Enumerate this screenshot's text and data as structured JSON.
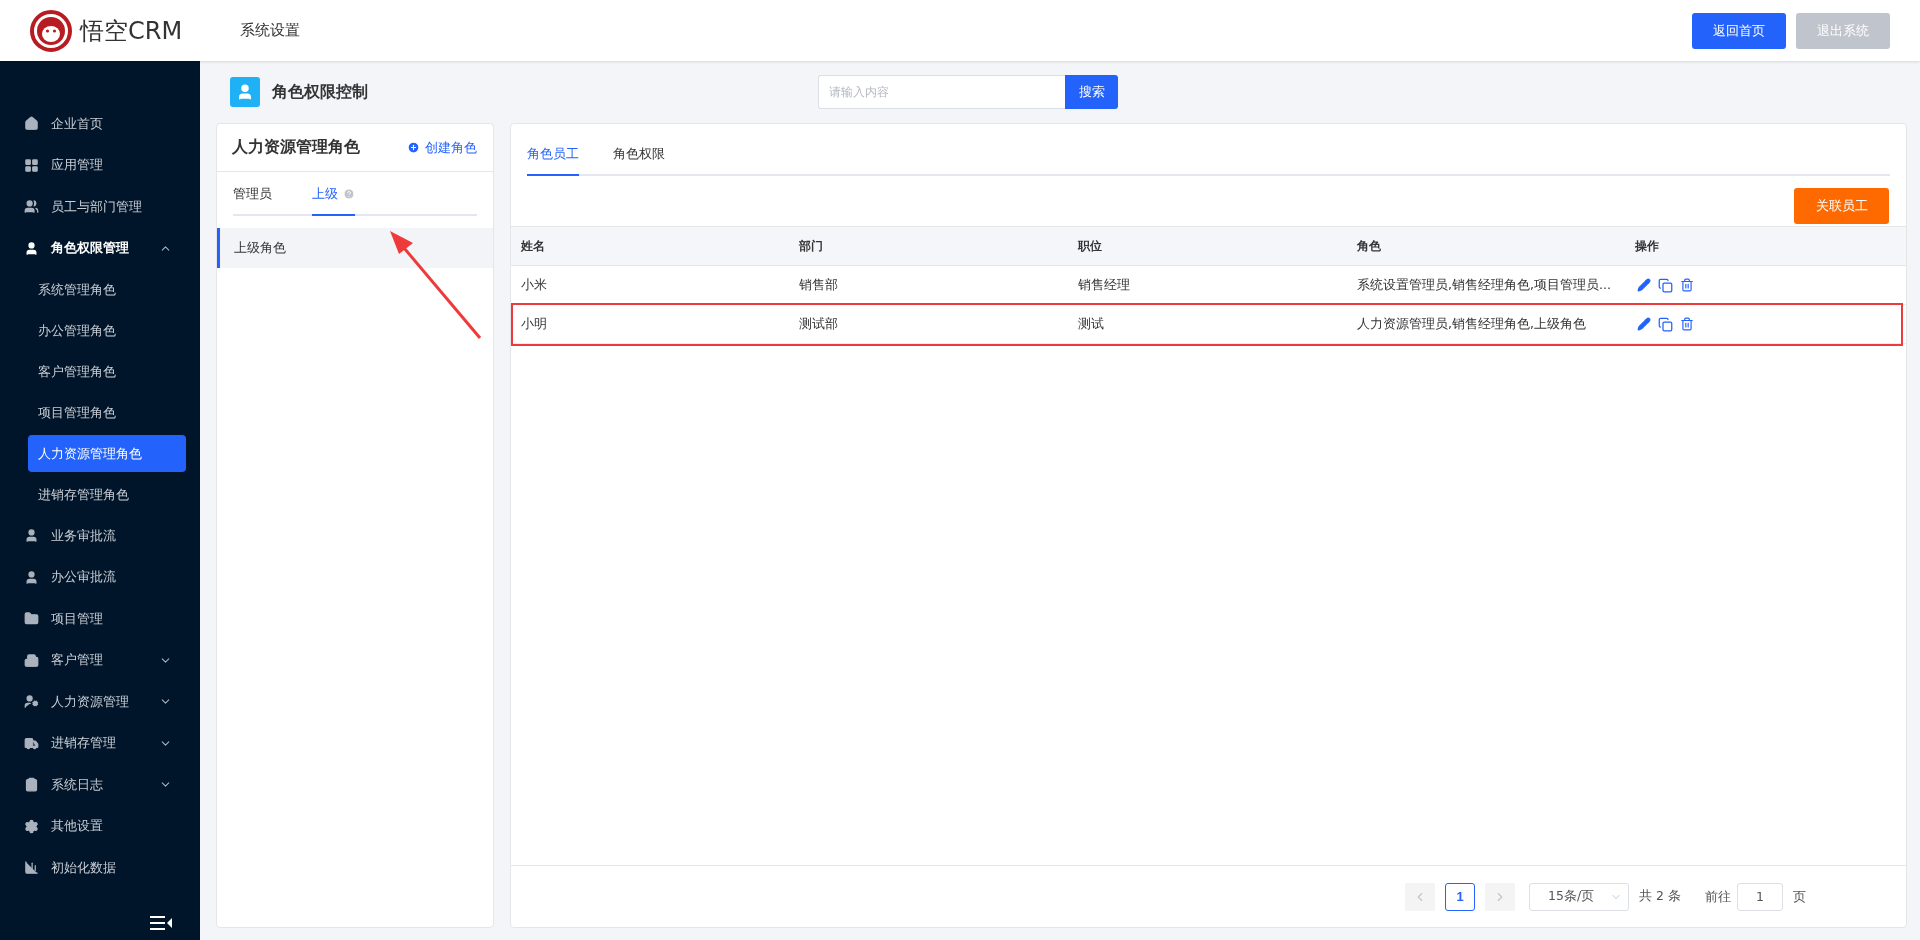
{
  "header": {
    "logo_text": "悟空CRM",
    "title": "系统设置",
    "buttons": [
      {
        "label": "返回首页",
        "kind": "primary"
      },
      {
        "label": "退出系统",
        "kind": "disabled"
      }
    ]
  },
  "sidebar": {
    "items": [
      {
        "label": "企业首页"
      },
      {
        "label": "应用管理"
      },
      {
        "label": "员工与部门管理"
      },
      {
        "label": "角色权限管理",
        "expanded": true,
        "children": [
          {
            "label": "系统管理角色",
            "selected": false
          },
          {
            "label": "办公管理角色",
            "selected": false
          },
          {
            "label": "客户管理角色",
            "selected": false
          },
          {
            "label": "项目管理角色",
            "selected": false
          },
          {
            "label": "人力资源管理角色",
            "selected": true
          },
          {
            "label": "进销存管理角色",
            "selected": false
          }
        ]
      },
      {
        "label": "业务审批流"
      },
      {
        "label": "办公审批流"
      },
      {
        "label": "项目管理"
      },
      {
        "label": "客户管理",
        "expanded": false
      },
      {
        "label": "人力资源管理",
        "expanded": false
      },
      {
        "label": "进销存管理",
        "expanded": false
      },
      {
        "label": "系统日志",
        "expanded": false
      },
      {
        "label": "其他设置"
      },
      {
        "label": "初始化数据"
      }
    ]
  },
  "page": {
    "title": "角色权限控制",
    "search": {
      "placeholder": "请输入内容",
      "button": "搜索"
    }
  },
  "role_panel": {
    "title": "人力资源管理角色",
    "create_link": "创建角色",
    "tabs": [
      {
        "label": "管理员",
        "selected": false
      },
      {
        "label": "上级",
        "selected": true
      }
    ],
    "roles": [
      {
        "label": "上级角色",
        "selected": true
      }
    ]
  },
  "main": {
    "tabs": [
      {
        "label": "角色员工",
        "selected": true
      },
      {
        "label": "角色权限",
        "selected": false
      }
    ],
    "action_button": "关联员工",
    "table": {
      "columns": [
        "姓名",
        "部门",
        "职位",
        "角色",
        "操作"
      ],
      "rows": [
        {
          "cells": [
            "小米",
            "销售部",
            "销售经理",
            "系统设置管理员,销售经理角色,项目管理员..."
          ],
          "annotated": false
        },
        {
          "cells": [
            "小明",
            "测试部",
            "测试",
            "人力资源管理员,销售经理角色,上级角色"
          ],
          "annotated": true
        }
      ]
    },
    "pagination": {
      "pages": [
        {
          "label": "1",
          "selected": true
        }
      ],
      "page_size": "15条/页",
      "total": "共 2 条",
      "goto_label": "前往",
      "goto_value": "1",
      "goto_suffix": "页"
    }
  }
}
